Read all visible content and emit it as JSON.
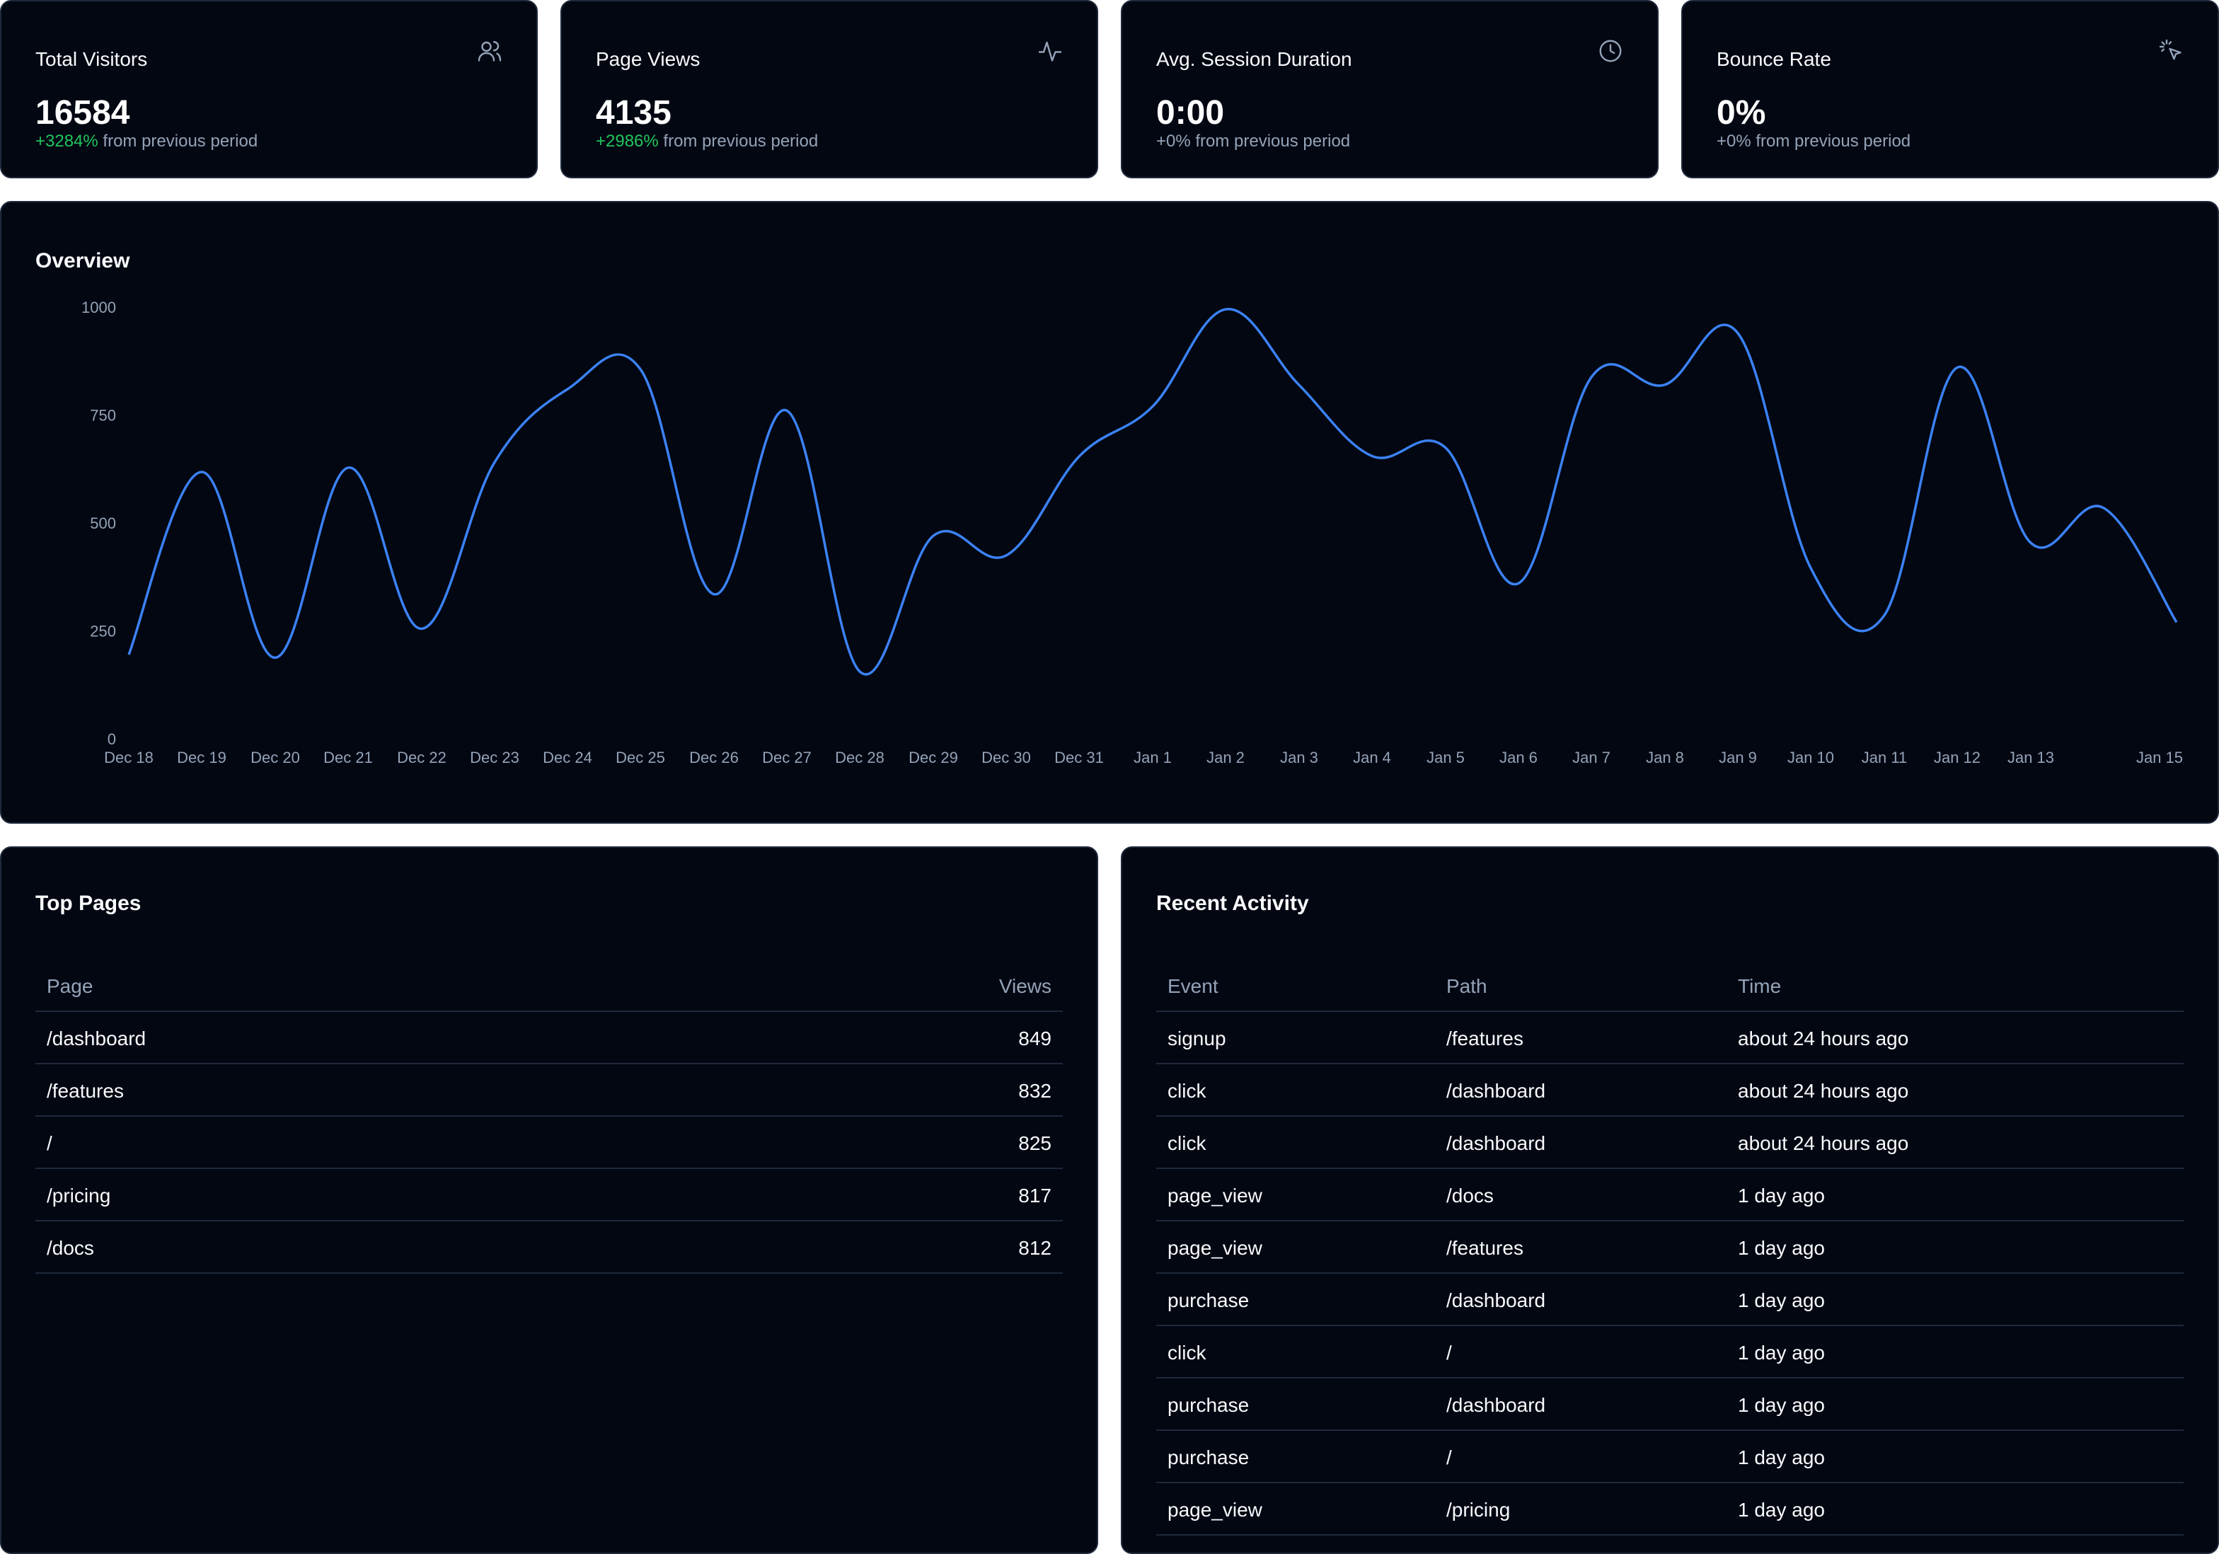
{
  "stats": [
    {
      "title": "Total Visitors",
      "value": "16584",
      "change_value": "+3284%",
      "change_text": " from previous period",
      "change_color": "#22c55e",
      "icon": "users-icon"
    },
    {
      "title": "Page Views",
      "value": "4135",
      "change_value": "+2986%",
      "change_text": " from previous period",
      "change_color": "#22c55e",
      "icon": "activity-icon"
    },
    {
      "title": "Avg. Session Duration",
      "value": "0:00",
      "change_value": "+0%",
      "change_text": " from previous period",
      "change_color": "#94a3b8",
      "icon": "clock-icon"
    },
    {
      "title": "Bounce Rate",
      "value": "0%",
      "change_value": "+0%",
      "change_text": " from previous period",
      "change_color": "#94a3b8",
      "icon": "pointer-icon"
    }
  ],
  "overview": {
    "title": "Overview"
  },
  "chart_data": {
    "type": "line",
    "title": "Overview",
    "ylim": [
      0,
      1000
    ],
    "yticks": [
      0,
      250,
      500,
      750,
      1000
    ],
    "line_color": "#3b82f6",
    "x": [
      "Dec 18",
      "",
      "Dec 19",
      "",
      "Dec 20",
      "",
      "Dec 21",
      "",
      "Dec 22",
      "",
      "Dec 23",
      "",
      "Dec 24",
      "",
      "Dec 25",
      "",
      "Dec 26",
      "",
      "Dec 27",
      "",
      "Dec 28",
      "",
      "Dec 29",
      "",
      "Dec 30",
      "",
      "Dec 31",
      "",
      "Jan 1",
      "",
      "Jan 2",
      "",
      "Jan 3",
      "",
      "Jan 4",
      "",
      "Jan 5",
      "",
      "Jan 6",
      "",
      "Jan 7",
      "",
      "Jan 8",
      "",
      "Jan 9",
      "",
      "Jan 10",
      "",
      "Jan 11",
      "",
      "Jan 12",
      "",
      "Jan 13",
      "",
      "",
      "",
      "Jan 15"
    ],
    "xlabels": [
      "Dec 18",
      "Dec 19",
      "Dec 20",
      "Dec 21",
      "Dec 22",
      "Dec 23",
      "Dec 24",
      "Dec 25",
      "Dec 26",
      "Dec 27",
      "Dec 28",
      "Dec 29",
      "Dec 30",
      "Dec 31",
      "Jan 1",
      "Jan 2",
      "Jan 3",
      "Jan 4",
      "Jan 5",
      "Jan 6",
      "Jan 7",
      "Jan 8",
      "Jan 9",
      "Jan 10",
      "Jan 11",
      "Jan 12",
      "Jan 13",
      "Jan 15"
    ],
    "series": [
      {
        "values": [
          195,
          618,
          188,
          628,
          255,
          640,
          810,
          855,
          335,
          760,
          155,
          470,
          425,
          655,
          770,
          995,
          820,
          655,
          675,
          360,
          838,
          820,
          940,
          395,
          285,
          860,
          455,
          535,
          270
        ]
      }
    ]
  },
  "top_pages": {
    "title": "Top Pages",
    "columns": [
      "Page",
      "Views"
    ],
    "rows": [
      [
        "/dashboard",
        "849"
      ],
      [
        "/features",
        "832"
      ],
      [
        "/",
        "825"
      ],
      [
        "/pricing",
        "817"
      ],
      [
        "/docs",
        "812"
      ]
    ]
  },
  "recent_activity": {
    "title": "Recent Activity",
    "columns": [
      "Event",
      "Path",
      "Time"
    ],
    "rows": [
      [
        "signup",
        "/features",
        "about 24 hours ago"
      ],
      [
        "click",
        "/dashboard",
        "about 24 hours ago"
      ],
      [
        "click",
        "/dashboard",
        "about 24 hours ago"
      ],
      [
        "page_view",
        "/docs",
        "1 day ago"
      ],
      [
        "page_view",
        "/features",
        "1 day ago"
      ],
      [
        "purchase",
        "/dashboard",
        "1 day ago"
      ],
      [
        "click",
        "/",
        "1 day ago"
      ],
      [
        "purchase",
        "/dashboard",
        "1 day ago"
      ],
      [
        "purchase",
        "/",
        "1 day ago"
      ],
      [
        "page_view",
        "/pricing",
        "1 day ago"
      ]
    ]
  }
}
